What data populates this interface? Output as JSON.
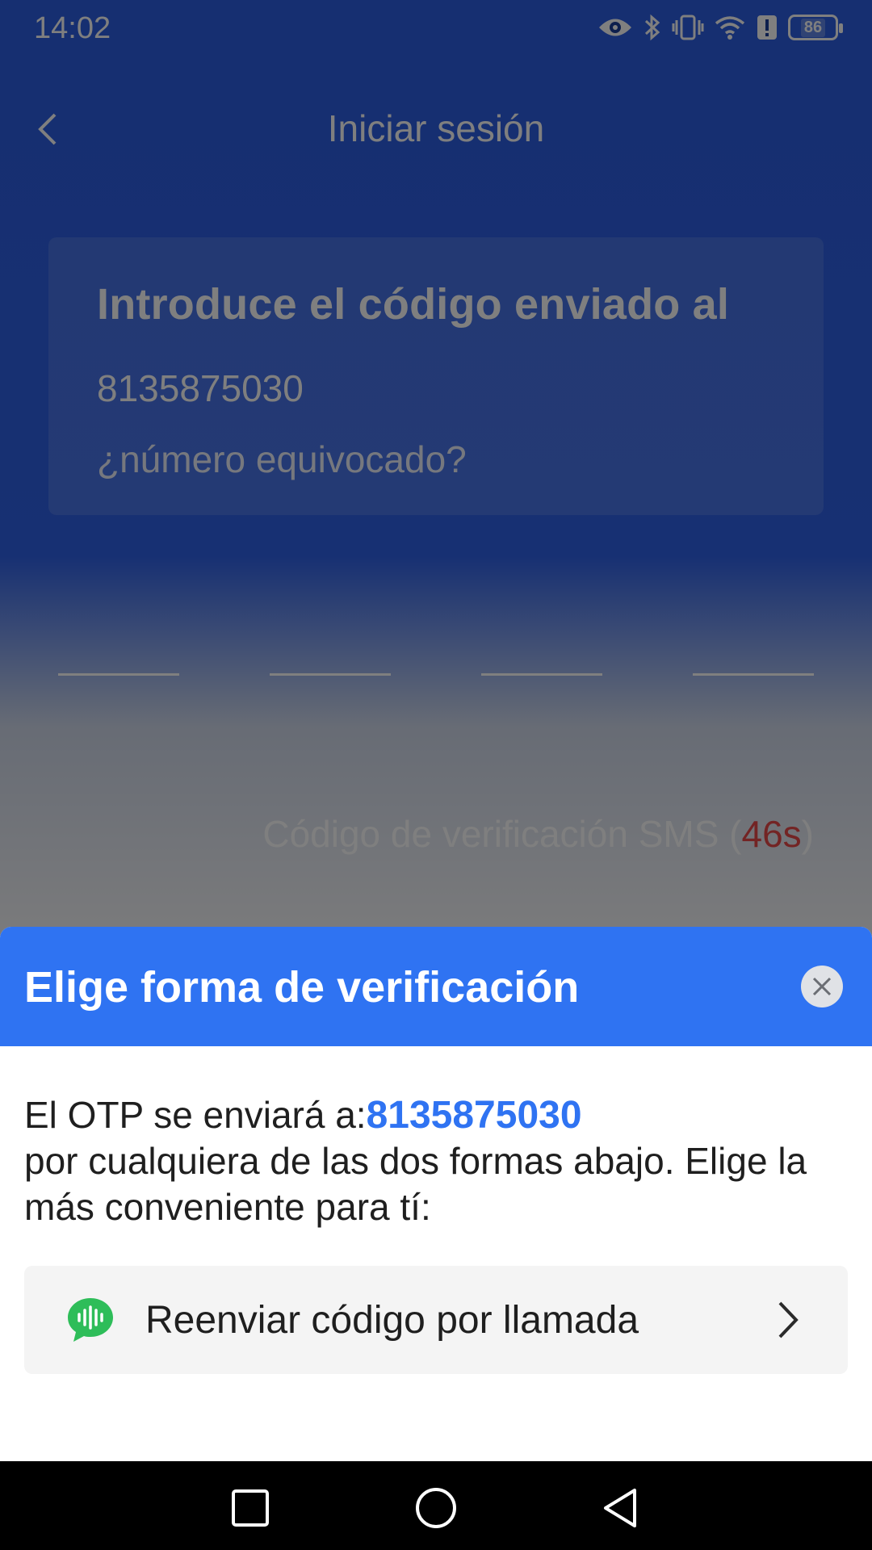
{
  "status_bar": {
    "time": "14:02",
    "battery": "86"
  },
  "header": {
    "title": "Iniciar sesión"
  },
  "card": {
    "heading": "Introduce el código enviado al",
    "phone": "8135875030",
    "wrong_number": "¿número equivocado?"
  },
  "sms": {
    "label": "Código de verificación SMS (",
    "seconds": "46s",
    "suffix": ")"
  },
  "sheet": {
    "title": "Elige forma de verificación",
    "desc_prefix": "El OTP se enviará a:",
    "phone": "8135875030",
    "desc_rest": "por cualquiera de las dos formas abajo. Elige la más conveniente para tí:",
    "option_label": "Reenviar código por llamada"
  },
  "colors": {
    "accent": "#2f73f2",
    "timer": "#e64848",
    "call_icon": "#2ebd59"
  }
}
